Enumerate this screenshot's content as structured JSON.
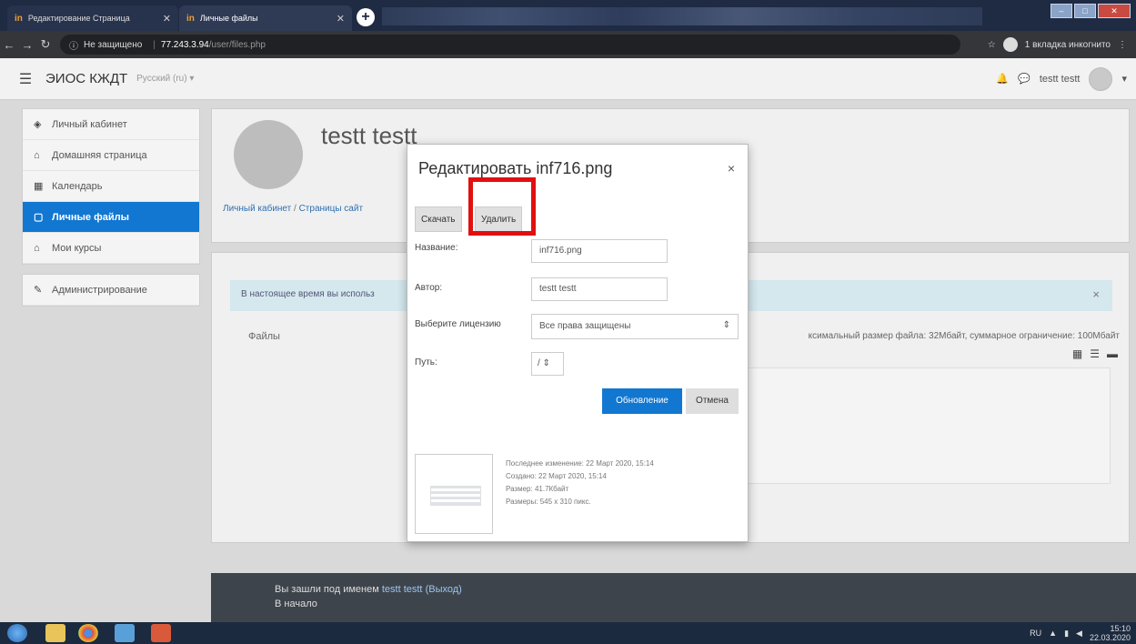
{
  "browser": {
    "tabs": [
      {
        "label": "Редактирование Страница"
      },
      {
        "label": "Личные файлы"
      }
    ],
    "insecure_label": "Не защищено",
    "url_host": "77.243.3.94",
    "url_path": "/user/files.php",
    "incognito_label": "1 вкладка инкогнито"
  },
  "site": {
    "brand": "ЭИОС КЖДТ",
    "language": "Русский (ru)",
    "user_name": "testt testt"
  },
  "sidebar": {
    "items": [
      {
        "label": "Личный кабинет",
        "icon": "dashboard-icon"
      },
      {
        "label": "Домашняя страница",
        "icon": "home-icon"
      },
      {
        "label": "Календарь",
        "icon": "calendar-icon"
      },
      {
        "label": "Личные файлы",
        "icon": "file-icon",
        "active": true
      },
      {
        "label": "Мои курсы",
        "icon": "graduation-cap-icon"
      }
    ],
    "admin_label": "Администрирование"
  },
  "main": {
    "profile_name": "testt testt",
    "breadcrumb": [
      "Личный кабинет",
      "Страницы сайт"
    ],
    "alert_text": "В настоящее время вы использ",
    "files_label": "Файлы",
    "files_info": "ксимальный размер файла: 32Мбайт, суммарное ограничение: 100Мбайт"
  },
  "modal": {
    "title": "Редактировать inf716.png",
    "download_label": "Скачать",
    "delete_label": "Удалить",
    "name_label": "Название:",
    "name_value": "inf716.png",
    "author_label": "Автор:",
    "author_value": "testt testt",
    "license_label": "Выберите лицензию",
    "license_value": "Все права защищены",
    "path_label": "Путь:",
    "path_value": "/",
    "update_label": "Обновление",
    "cancel_label": "Отмена",
    "meta": {
      "modified": "Последнее изменение: 22 Март 2020, 15:14",
      "created": "Создано: 22 Март 2020, 15:14",
      "size": "Размер: 41.7Кбайт",
      "dimensions": "Размеры: 545 x 310 пикс."
    }
  },
  "footer": {
    "logged_in_prefix": "Вы зашли под именем",
    "user_link": "testt testt",
    "logout_link": "(Выход)",
    "home_link": "В начало"
  },
  "taskbar": {
    "lang": "RU",
    "time": "15:10",
    "date": "22.03.2020"
  },
  "colors": {
    "accent": "#1177d1",
    "highlight": "#e11010",
    "footer": "#3e444b"
  }
}
